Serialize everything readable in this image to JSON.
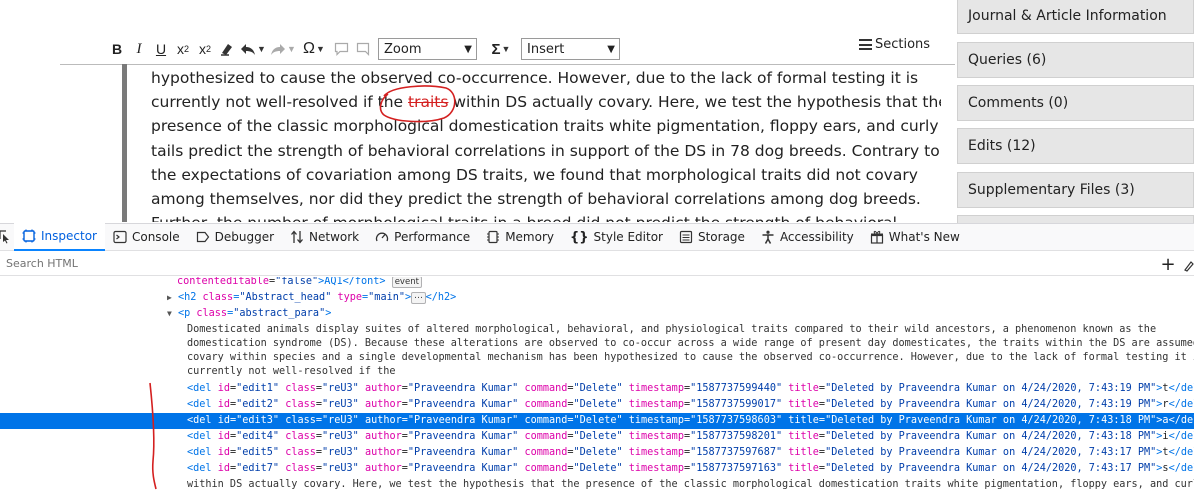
{
  "toolbar": {
    "bold": "B",
    "italic": "I",
    "underline": "U",
    "superscript_base": "x",
    "superscript_mark": "2",
    "subscript_base": "x",
    "subscript_mark": "2",
    "omega": "Ω",
    "sigma": "Σ",
    "zoom_value": "Zoom",
    "insert_value": "Insert",
    "sections_label": "Sections"
  },
  "document": {
    "lines": [
      "hypothesized to cause the observed co-occurrence. However, due to the lack of formal testing it is",
      "presence of the classic morphological domestication traits white pigmentation, floppy ears, and curly",
      "tails predict the strength of behavioral correlations in support of the DS in 78 dog breeds. Contrary to",
      "the expectations of covariation among DS traits, we found that morphological traits did not covary",
      "among themselves, nor did they predict the strength of behavioral correlations among dog breeds.",
      "Further, the number of morphological traits in a breed did not predict the strength of behavioral"
    ],
    "line2_before": "currently not well-resolved if the ",
    "line2_deleted": "traits",
    "line2_after": " within DS actually covary. Here, we test the hypothesis that the"
  },
  "side_panel": [
    {
      "label": "Journal & Article Information"
    },
    {
      "label": "Queries (6)"
    },
    {
      "label": "Comments (0)"
    },
    {
      "label": "Edits (12)"
    },
    {
      "label": "Supplementary Files (3)"
    }
  ],
  "devtools": {
    "tabs": [
      {
        "label": "Inspector",
        "icon": "inspector-icon"
      },
      {
        "label": "Console",
        "icon": "console-icon"
      },
      {
        "label": "Debugger",
        "icon": "debugger-icon"
      },
      {
        "label": "Network",
        "icon": "network-icon"
      },
      {
        "label": "Performance",
        "icon": "performance-icon"
      },
      {
        "label": "Memory",
        "icon": "memory-icon"
      },
      {
        "label": "Style Editor",
        "icon": "style-editor-icon"
      },
      {
        "label": "Storage",
        "icon": "storage-icon"
      },
      {
        "label": "Accessibility",
        "icon": "accessibility-icon"
      },
      {
        "label": "What's New",
        "icon": "whats-new-icon"
      }
    ],
    "search_placeholder": "Search HTML",
    "markup": {
      "line0_attr": "contenteditable",
      "line0_val": "\"false\"",
      "line0_text": ">AQ1</font>",
      "event_badge": "event",
      "h2_tag": "<h2",
      "h2_class_attr": "class",
      "h2_class_val": "\"Abstract_head\"",
      "h2_type_attr": "type",
      "h2_type_val": "\"main\"",
      "h2_close": "</h2>",
      "p_tag": "<p",
      "p_class_attr": "class",
      "p_class_val": "\"abstract_para\"",
      "para_lines": [
        "Domesticated animals display suites of altered morphological, behavioral, and physiological traits compared to their wild ancestors, a phenomenon known as the",
        "domestication syndrome (DS). Because these alterations are observed to co-occur across a wide range of present day domesticates, the traits within the DS are assumed to",
        "covary within species and a single developmental mechanism has been hypothesized to cause the observed co-occurrence. However, due to the lack of formal testing it is",
        "currently not well-resolved if the"
      ],
      "del_rows": [
        {
          "id": "\"edit1\"",
          "ts": "\"1587737599440\"",
          "title": "\"Deleted by Praveendra Kumar on 4/24/2020, 7:43:19 PM\"",
          "ch": "t"
        },
        {
          "id": "\"edit2\"",
          "ts": "\"1587737599017\"",
          "title": "\"Deleted by Praveendra Kumar on 4/24/2020, 7:43:19 PM\"",
          "ch": "r"
        },
        {
          "id": "\"edit3\"",
          "ts": "\"1587737598603\"",
          "title": "\"Deleted by Praveendra Kumar on 4/24/2020, 7:43:18 PM\"",
          "ch": "a"
        },
        {
          "id": "\"edit4\"",
          "ts": "\"1587737598201\"",
          "title": "\"Deleted by Praveendra Kumar on 4/24/2020, 7:43:18 PM\"",
          "ch": "i"
        },
        {
          "id": "\"edit5\"",
          "ts": "\"1587737597687\"",
          "title": "\"Deleted by Praveendra Kumar on 4/24/2020, 7:43:17 PM\"",
          "ch": "t"
        },
        {
          "id": "\"edit7\"",
          "ts": "\"1587737597163\"",
          "title": "\"Deleted by Praveendra Kumar on 4/24/2020, 7:43:17 PM\"",
          "ch": "s"
        }
      ],
      "del_class_val": "\"reU3\"",
      "del_author_val": "\"Praveendra Kumar\"",
      "del_command_val": "\"Delete\"",
      "last_line": "within DS actually covary. Here, we test the hypothesis that the presence of the classic morphological domestication traits white pigmentation, floppy ears, and curly"
    }
  },
  "colors": {
    "selected_row": "#0074e8",
    "annotation_red": "#d42020",
    "tab_active": "#0060df"
  }
}
